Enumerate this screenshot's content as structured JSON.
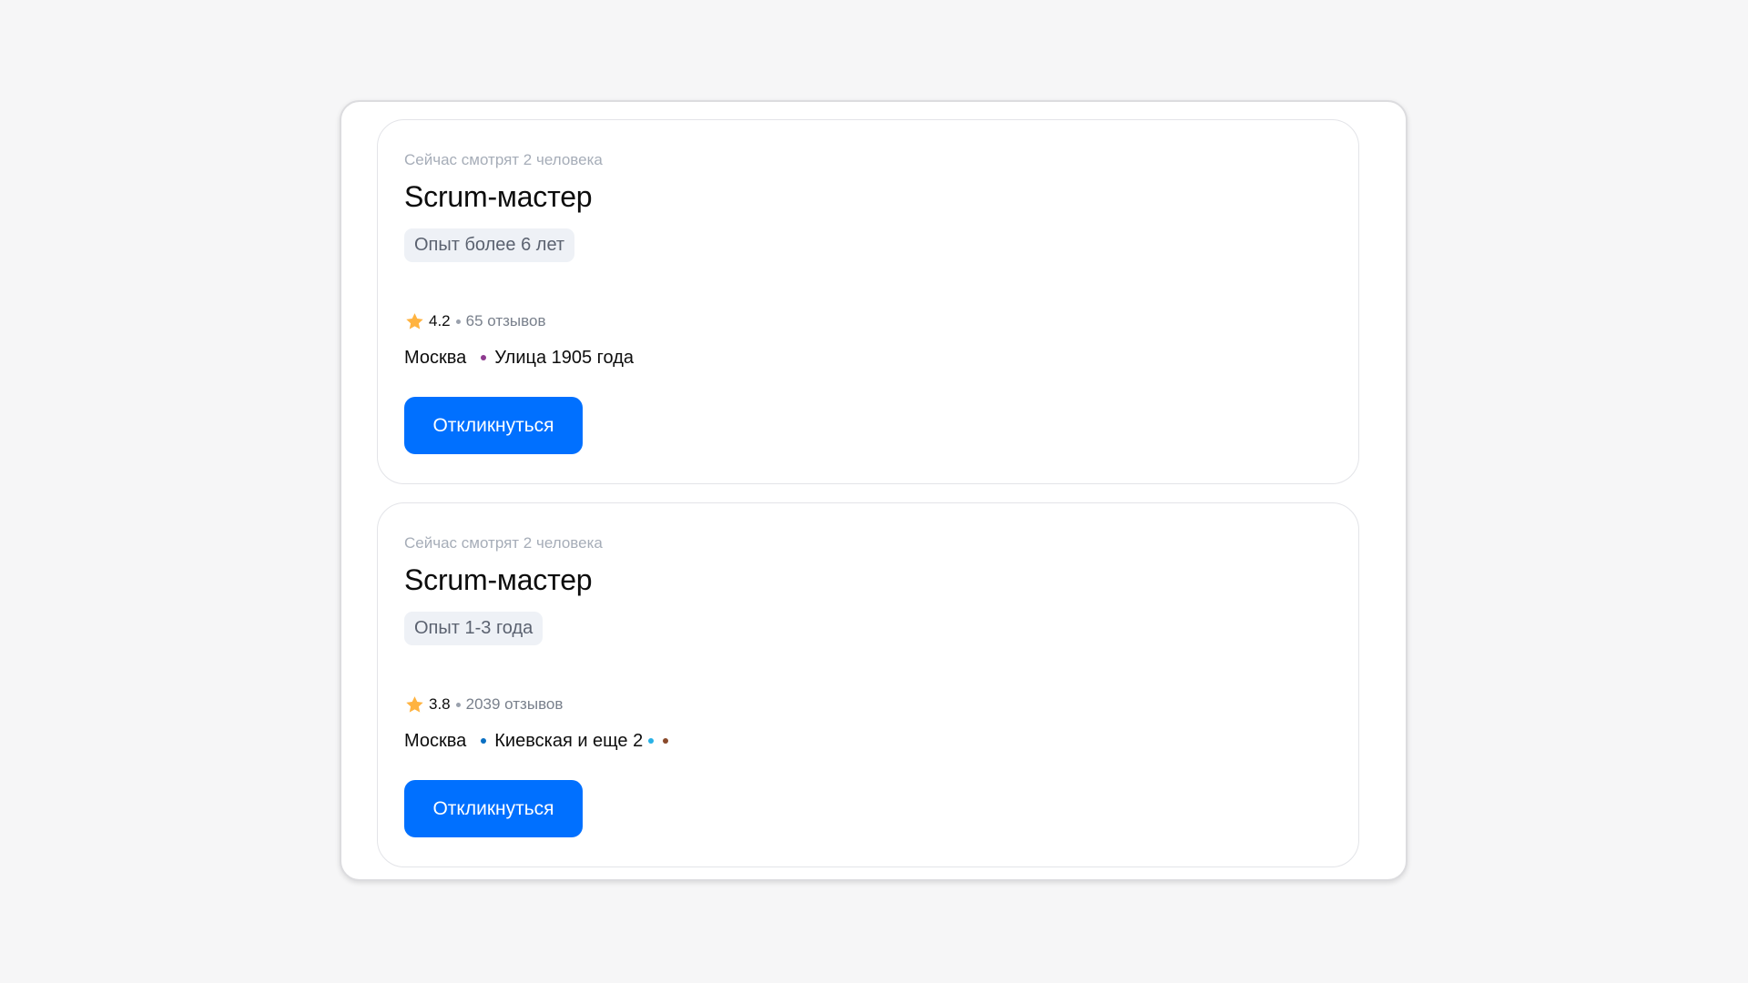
{
  "vacancies": [
    {
      "viewers": "Сейчас смотрят 2 человека",
      "title": "Scrum-мастер",
      "experience": "Опыт более 6 лет",
      "rating": "4.2",
      "reviews": "65 отзывов",
      "city": "Москва",
      "metro": "Улица 1905 года",
      "metro_color": "#8e3a8f",
      "extra_metro_colors": [],
      "apply_label": "Откликнуться"
    },
    {
      "viewers": "Сейчас смотрят 2 человека",
      "title": "Scrum-мастер",
      "experience": "Опыт 1-3 года",
      "rating": "3.8",
      "reviews": "2039 отзывов",
      "city": "Москва",
      "metro": "Киевская и еще 2",
      "metro_color": "#0a6fc2",
      "extra_metro_colors": [
        "#29b1e6",
        "#8a4a2b"
      ],
      "apply_label": "Откликнуться"
    }
  ],
  "colors": {
    "accent": "#0070ff",
    "star": "#ffb340",
    "background": "#f6f6f7"
  },
  "icons": {
    "rating": "star-icon"
  }
}
